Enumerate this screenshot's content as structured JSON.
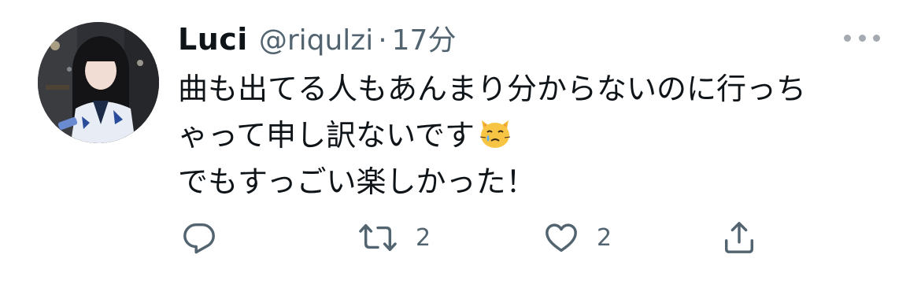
{
  "tweet": {
    "author": {
      "display_name": "Luci",
      "handle": "@riqulzi"
    },
    "separator": "·",
    "timestamp": "17分",
    "text_lines": [
      "曲も出てる人もあんまり分からないのに行っち",
      "ゃって申し訳ないです",
      "でもすっごい楽しかった！"
    ],
    "emoji": "crying-cat-face",
    "actions": {
      "reply_icon": "reply-icon",
      "retweet_icon": "retweet-icon",
      "retweet_count": "2",
      "like_icon": "heart-icon",
      "like_count": "2",
      "share_icon": "share-icon"
    },
    "colors": {
      "text": "#0f1419",
      "secondary": "#536471",
      "icon": "#536471"
    }
  }
}
